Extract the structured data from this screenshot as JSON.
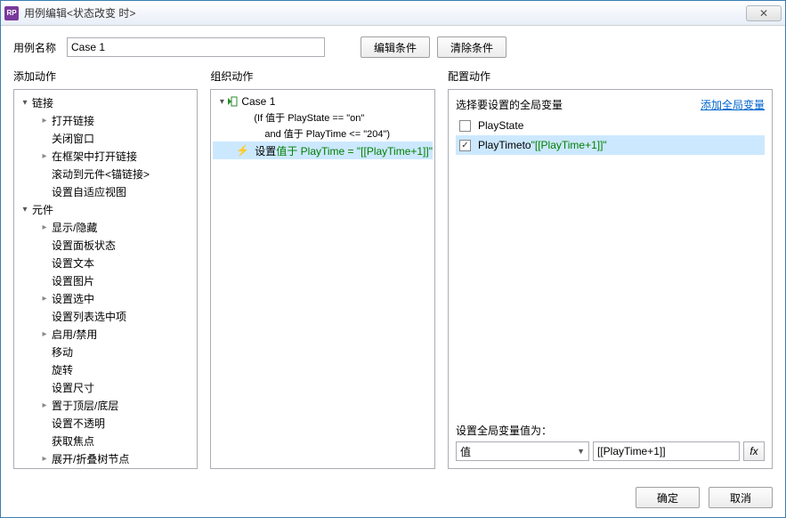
{
  "window": {
    "title": "用例编辑<状态改变 时>",
    "close_glyph": "✕"
  },
  "case_name_label": "用例名称",
  "case_name_value": "Case 1",
  "buttons": {
    "edit_condition": "编辑条件",
    "clear_condition": "清除条件",
    "ok": "确定",
    "cancel": "取消"
  },
  "columns": {
    "add_action": "添加动作",
    "organize_action": "组织动作",
    "configure_action": "配置动作"
  },
  "action_tree": [
    {
      "label": "链接",
      "depth": 0,
      "expand": "open"
    },
    {
      "label": "打开链接",
      "depth": 1,
      "expand": "closed"
    },
    {
      "label": "关闭窗口",
      "depth": 1,
      "expand": "none"
    },
    {
      "label": "在框架中打开链接",
      "depth": 1,
      "expand": "closed"
    },
    {
      "label": "滚动到元件<锚链接>",
      "depth": 1,
      "expand": "none"
    },
    {
      "label": "设置自适应视图",
      "depth": 1,
      "expand": "none"
    },
    {
      "label": "元件",
      "depth": 0,
      "expand": "open"
    },
    {
      "label": "显示/隐藏",
      "depth": 1,
      "expand": "closed"
    },
    {
      "label": "设置面板状态",
      "depth": 1,
      "expand": "none"
    },
    {
      "label": "设置文本",
      "depth": 1,
      "expand": "none"
    },
    {
      "label": "设置图片",
      "depth": 1,
      "expand": "none"
    },
    {
      "label": "设置选中",
      "depth": 1,
      "expand": "closed"
    },
    {
      "label": "设置列表选中项",
      "depth": 1,
      "expand": "none"
    },
    {
      "label": "启用/禁用",
      "depth": 1,
      "expand": "closed"
    },
    {
      "label": "移动",
      "depth": 1,
      "expand": "none"
    },
    {
      "label": "旋转",
      "depth": 1,
      "expand": "none"
    },
    {
      "label": "设置尺寸",
      "depth": 1,
      "expand": "none"
    },
    {
      "label": "置于顶层/底层",
      "depth": 1,
      "expand": "closed"
    },
    {
      "label": "设置不透明",
      "depth": 1,
      "expand": "none"
    },
    {
      "label": "获取焦点",
      "depth": 1,
      "expand": "none"
    },
    {
      "label": "展开/折叠树节点",
      "depth": 1,
      "expand": "closed"
    }
  ],
  "organize": {
    "case_label": "Case 1",
    "cond_line1": "(If 值于 PlayState == \"on\"",
    "cond_line2": "and 值于 PlayTime <= \"204\")",
    "action_prefix": "设置 ",
    "action_green": "值于 PlayTime = \"[[PlayTime+1]]\""
  },
  "configure": {
    "select_var_label": "选择要设置的全局变量",
    "add_global_link": "添加全局变量",
    "vars": [
      {
        "name": "PlayState",
        "checked": false,
        "suffix": ""
      },
      {
        "name": "PlayTime",
        "checked": true,
        "suffix_prefix": " to ",
        "suffix_green": "\"[[PlayTime+1]]\""
      }
    ],
    "set_value_label": "设置全局变量值为：",
    "value_type": "值",
    "value_text": "[[PlayTime+1]]",
    "fx_label": "fx"
  }
}
